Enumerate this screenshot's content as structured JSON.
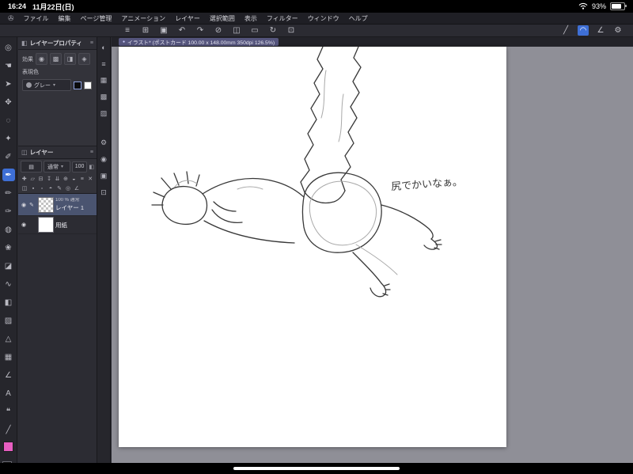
{
  "status_bar": {
    "time": "16:24",
    "date": "11月22日(日)",
    "battery": "93%"
  },
  "menu_bar": {
    "logo_glyph": "✇",
    "items": [
      "ファイル",
      "編集",
      "ページ管理",
      "アニメーション",
      "レイヤー",
      "選択範囲",
      "表示",
      "フィルター",
      "ウィンドウ",
      "ヘルプ"
    ]
  },
  "toolbar": {
    "left": [
      {
        "name": "main-menu",
        "glyph": "≡"
      },
      {
        "name": "new-canvas",
        "glyph": "⊞"
      },
      {
        "name": "save",
        "glyph": "▣"
      },
      {
        "name": "undo",
        "glyph": "↶"
      },
      {
        "name": "redo",
        "glyph": "↷"
      },
      {
        "name": "clear",
        "glyph": "⊘"
      },
      {
        "name": "deselect",
        "glyph": "◫"
      },
      {
        "name": "select-area",
        "glyph": "▭"
      },
      {
        "name": "rotate-canvas",
        "glyph": "↻"
      },
      {
        "name": "fit-to-screen",
        "glyph": "⊡"
      }
    ],
    "right": [
      {
        "name": "snap-to-ruler",
        "glyph": "╱",
        "selected": false
      },
      {
        "name": "snap-to-special-ruler",
        "glyph": "◠",
        "selected": true
      },
      {
        "name": "snap-to-grid",
        "glyph": "∠",
        "selected": false
      },
      {
        "name": "toolbar-settings",
        "glyph": "⚙",
        "selected": false
      }
    ]
  },
  "document_tab": {
    "bullet": "●",
    "label": "イラスト* (ポストカード 100.00 x 148.00mm 350dpi 126.5%)"
  },
  "tool_strip": {
    "main_color": "#e75ec1",
    "tools": [
      {
        "name": "zoom",
        "glyph": "◎"
      },
      {
        "name": "hand",
        "glyph": "☚"
      },
      {
        "name": "operation",
        "glyph": "➤"
      },
      {
        "name": "layer-move",
        "glyph": "✥"
      },
      {
        "name": "selection",
        "glyph": "◌"
      },
      {
        "name": "auto-select",
        "glyph": "✦"
      },
      {
        "name": "eyedropper",
        "glyph": "✐"
      },
      {
        "name": "pen",
        "glyph": "✒",
        "selected": true
      },
      {
        "name": "pencil",
        "glyph": "✏"
      },
      {
        "name": "brush",
        "glyph": "✑"
      },
      {
        "name": "airbrush",
        "glyph": "◍"
      },
      {
        "name": "decoration",
        "glyph": "❀"
      },
      {
        "name": "eraser",
        "glyph": "◪"
      },
      {
        "name": "blend",
        "glyph": "∿"
      },
      {
        "name": "fill",
        "glyph": "◧"
      },
      {
        "name": "gradient",
        "glyph": "▨"
      },
      {
        "name": "figure",
        "glyph": "△"
      },
      {
        "name": "frame-border",
        "glyph": "▦"
      },
      {
        "name": "ruler",
        "glyph": "∠"
      },
      {
        "name": "text",
        "glyph": "A"
      },
      {
        "name": "balloon",
        "glyph": "❝"
      },
      {
        "name": "line-correction",
        "glyph": "╱"
      }
    ]
  },
  "layer_property": {
    "title": "レイヤープロパティ",
    "header_icon": "◧",
    "menu_glyph": "≡",
    "effect_label": "効果",
    "effect_icons": [
      {
        "name": "border-effect",
        "glyph": "◉"
      },
      {
        "name": "tone-effect",
        "glyph": "▩"
      },
      {
        "name": "layer-color",
        "glyph": "◨"
      },
      {
        "name": "extract-line",
        "glyph": "◈"
      }
    ],
    "color_label": "表現色",
    "color_mode": "グレー",
    "caret": "▾"
  },
  "layer_panel": {
    "title": "レイヤー",
    "header_icon": "◫",
    "menu_glyph": "≡",
    "palette_glyph": "▤",
    "caret": "▾",
    "blend_mode": "通常",
    "opacity": "100",
    "opacity_icon": "◧",
    "eye_glyph": "◉",
    "edit_glyph": "✎",
    "action_icons_row1": [
      {
        "name": "new-layer",
        "glyph": "✚"
      },
      {
        "name": "new-folder",
        "glyph": "▱"
      },
      {
        "name": "duplicate-layer",
        "glyph": "⊟"
      },
      {
        "name": "transfer-down",
        "glyph": "↧"
      },
      {
        "name": "merge-down",
        "glyph": "⇊"
      },
      {
        "name": "combine-layers",
        "glyph": "⊕"
      },
      {
        "name": "layer-mask",
        "glyph": "◒"
      },
      {
        "name": "layer-menu",
        "glyph": "≡"
      },
      {
        "name": "delete-layer",
        "glyph": "✕"
      }
    ],
    "action_icons_row2": [
      {
        "name": "clip-to-layer-below",
        "glyph": "◫"
      },
      {
        "name": "lock-layer",
        "glyph": "▪"
      },
      {
        "name": "lock-transparent-pixels",
        "glyph": "▫"
      },
      {
        "name": "enable-mask",
        "glyph": "◓"
      },
      {
        "name": "set-as-draft",
        "glyph": "✎"
      },
      {
        "name": "set-as-reference",
        "glyph": "◎"
      },
      {
        "name": "ruler-range",
        "glyph": "∠"
      }
    ],
    "layers": [
      {
        "name": "レイヤー 1",
        "info": "100 % 通常",
        "selected": true,
        "visible": true
      },
      {
        "name": "用紙",
        "selected": false,
        "visible": true
      }
    ]
  },
  "dock": {
    "icons": [
      {
        "name": "color-wheel",
        "glyph": "◐"
      },
      {
        "name": "color-sliders",
        "glyph": "≡"
      },
      {
        "name": "color-set",
        "glyph": "▦"
      },
      {
        "name": "approximate-colors",
        "glyph": "▩"
      },
      {
        "name": "intermediate-colors",
        "glyph": "▨"
      },
      {
        "name": "tool-property",
        "glyph": "⚙"
      },
      {
        "name": "brush-size",
        "glyph": "◉"
      },
      {
        "name": "material",
        "glyph": "▣"
      },
      {
        "name": "navigator",
        "glyph": "⊡"
      }
    ]
  },
  "canvas": {
    "annotation": "尻でかいなぁ。"
  },
  "colors": {
    "accent_blue": "#3e6fd6",
    "tab_purple": "#55557d",
    "workspace_gray": "#8f8f97",
    "selected_layer_row": "#4a5470",
    "main_swatch_pink": "#e75ec1",
    "status_bar_black": "#000000"
  }
}
